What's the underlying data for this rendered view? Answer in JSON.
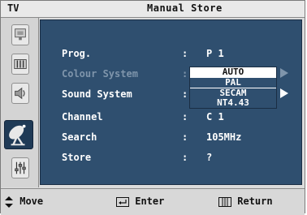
{
  "header": {
    "tv_label": "TV",
    "title": "Manual Store"
  },
  "sidebar": {
    "items": [
      {
        "icon": "picture-menu-icon"
      },
      {
        "icon": "sound-menu-icon"
      },
      {
        "icon": "speaker-menu-icon"
      },
      {
        "icon": "antenna-menu-icon",
        "active": true
      },
      {
        "icon": "setup-menu-icon"
      }
    ]
  },
  "menu": {
    "rows": [
      {
        "label": "Prog.",
        "colon": ":",
        "value": "P 1"
      },
      {
        "label": "Colour System",
        "colon": ":",
        "value": ""
      },
      {
        "label": "Sound System",
        "colon": ":",
        "value": ""
      },
      {
        "label": "Channel",
        "colon": ":",
        "value": "C 1"
      },
      {
        "label": "Search",
        "colon": ":",
        "value": "105MHz"
      },
      {
        "label": "Store",
        "colon": ":",
        "value": "?"
      }
    ],
    "colour_options": [
      "AUTO",
      "PAL",
      "SECAM",
      "NT4.43"
    ],
    "selected_option": "AUTO"
  },
  "footer": {
    "move": "Move",
    "enter": "Enter",
    "return": "Return"
  },
  "colors": {
    "panel": "#2f4f6f",
    "frame": "#dcdcdc",
    "dim_text": "#7f95ab",
    "active_icon": "#1f3a56"
  }
}
